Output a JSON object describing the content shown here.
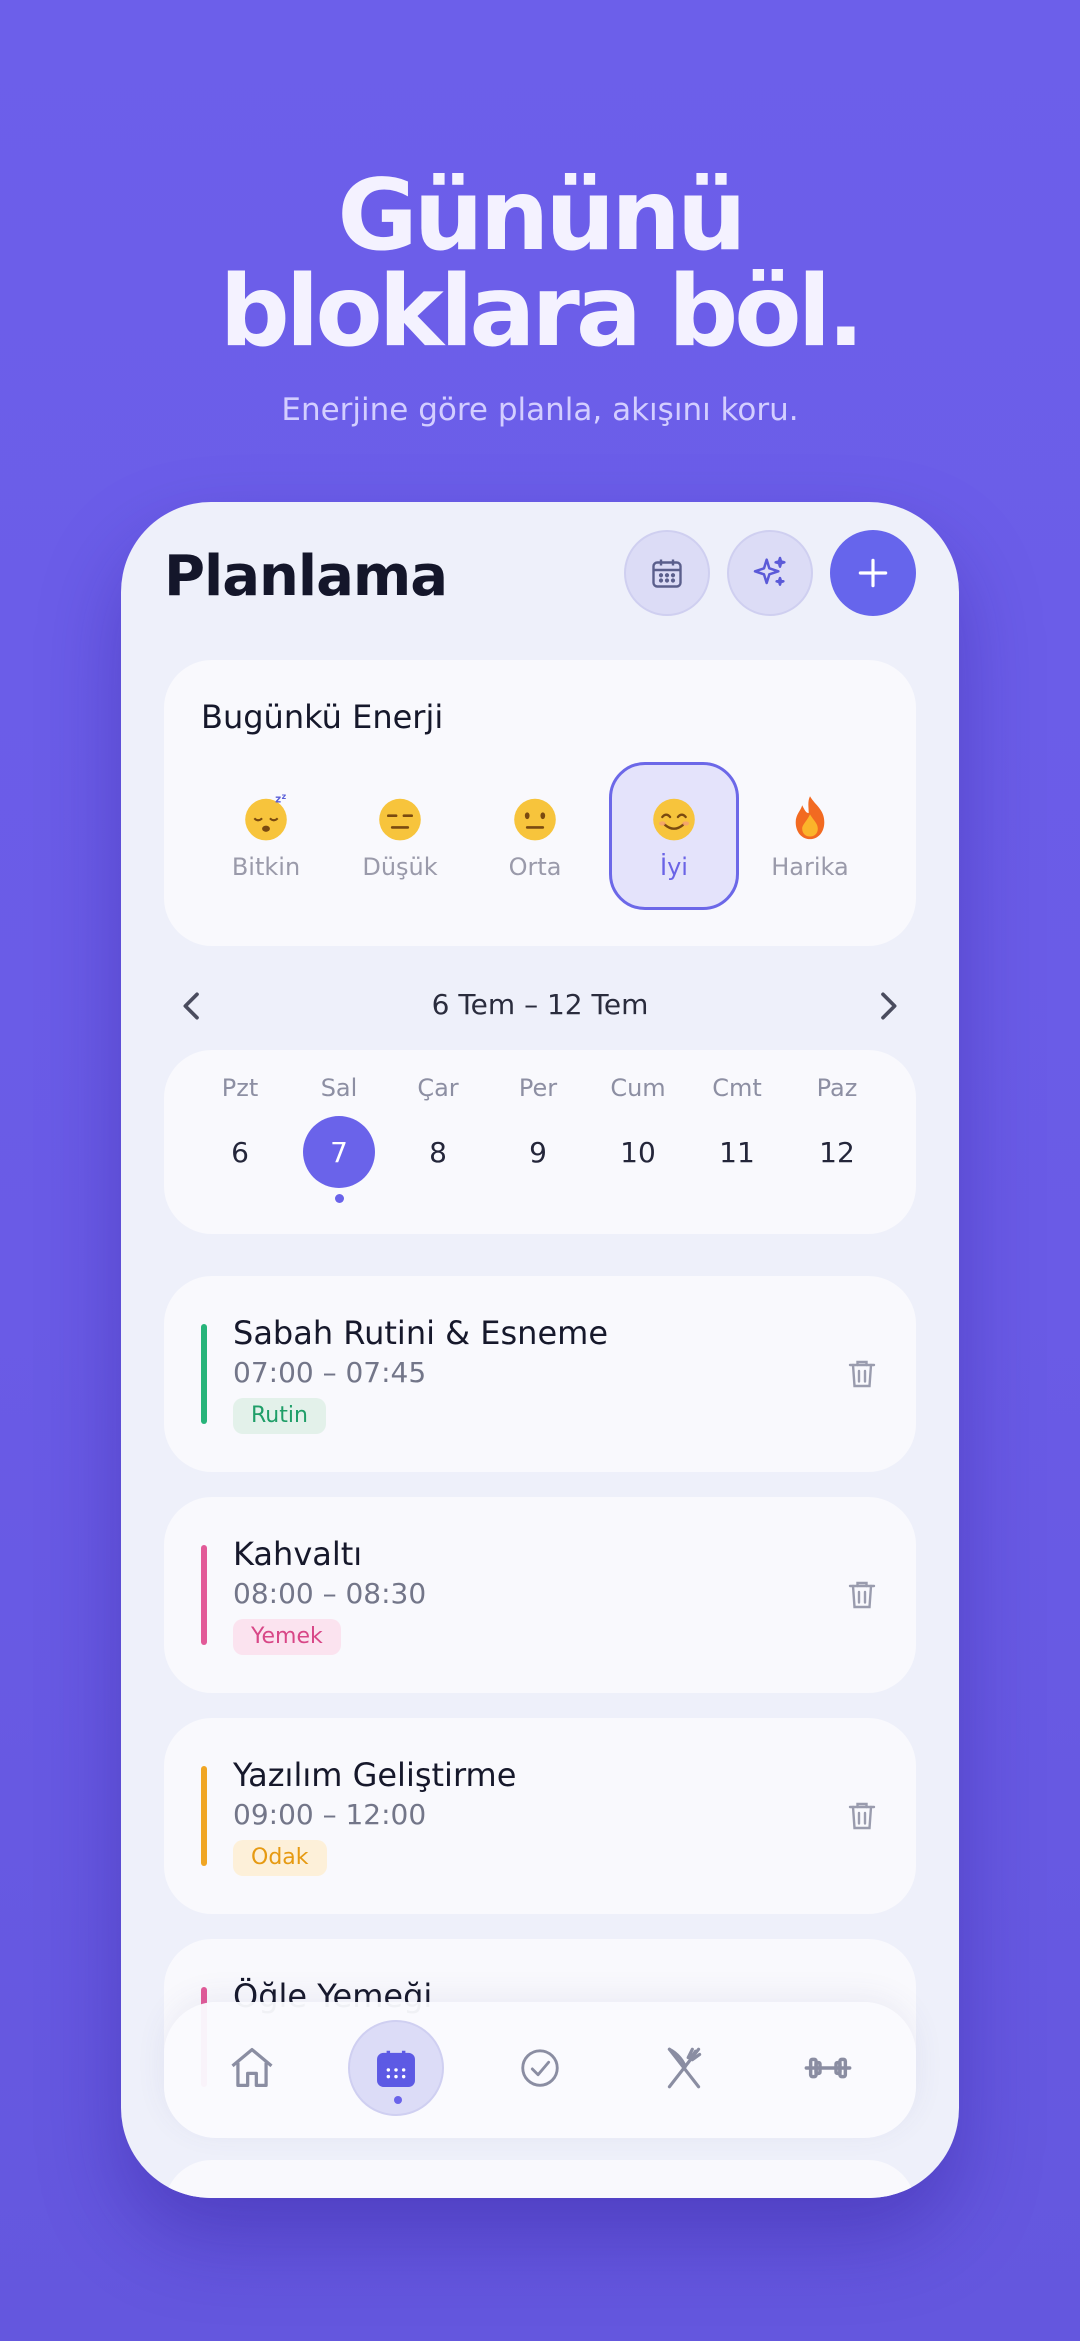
{
  "hero": {
    "title_line1": "Gününü",
    "title_line2": "bloklara böl.",
    "subtitle": "Enerjine göre planla, akışını koru."
  },
  "header": {
    "title": "Planlama",
    "buttons": [
      {
        "icon": "calendar-icon"
      },
      {
        "icon": "sparkles-icon"
      },
      {
        "icon": "plus-icon"
      }
    ]
  },
  "energy": {
    "title": "Bugünkü Enerji",
    "selected": "İyi",
    "levels": [
      {
        "label": "Bitkin",
        "icon": "sleepy-face-icon"
      },
      {
        "label": "Düşük",
        "icon": "expressionless-face-icon"
      },
      {
        "label": "Orta",
        "icon": "neutral-face-icon"
      },
      {
        "label": "İyi",
        "icon": "smiling-face-icon"
      },
      {
        "label": "Harika",
        "icon": "fire-icon"
      }
    ]
  },
  "week": {
    "range": "6 Tem – 12 Tem",
    "selected_day": "7",
    "days": [
      {
        "name": "Pzt",
        "num": "6"
      },
      {
        "name": "Sal",
        "num": "7"
      },
      {
        "name": "Çar",
        "num": "8"
      },
      {
        "name": "Per",
        "num": "9"
      },
      {
        "name": "Cum",
        "num": "10"
      },
      {
        "name": "Cmt",
        "num": "11"
      },
      {
        "name": "Paz",
        "num": "12"
      }
    ]
  },
  "tasks": [
    {
      "title": "Sabah Rutini & Esneme",
      "time": "07:00 – 07:45",
      "tag": "Rutin",
      "color": "#27b47a",
      "tag_bg": "#e3f1ea",
      "tag_color": "#1f9e68"
    },
    {
      "title": "Kahvaltı",
      "time": "08:00 – 08:30",
      "tag": "Yemek",
      "color": "#e25a98",
      "tag_bg": "#fbe3ef",
      "tag_color": "#d84787"
    },
    {
      "title": "Yazılım Geliştirme",
      "time": "09:00 – 12:00",
      "tag": "Odak",
      "color": "#f0a624",
      "tag_bg": "#fdf0d9",
      "tag_color": "#e69a12"
    },
    {
      "title": "Öğle Yemeği",
      "color": "#e25a98"
    }
  ],
  "tabbar": {
    "active": "calendar",
    "items": [
      "home-icon",
      "calendar-icon",
      "check-circle-icon",
      "fork-knife-icon",
      "dumbbell-icon"
    ]
  },
  "colors": {
    "accent": "#6a63ea",
    "background": "#6c5fea"
  }
}
